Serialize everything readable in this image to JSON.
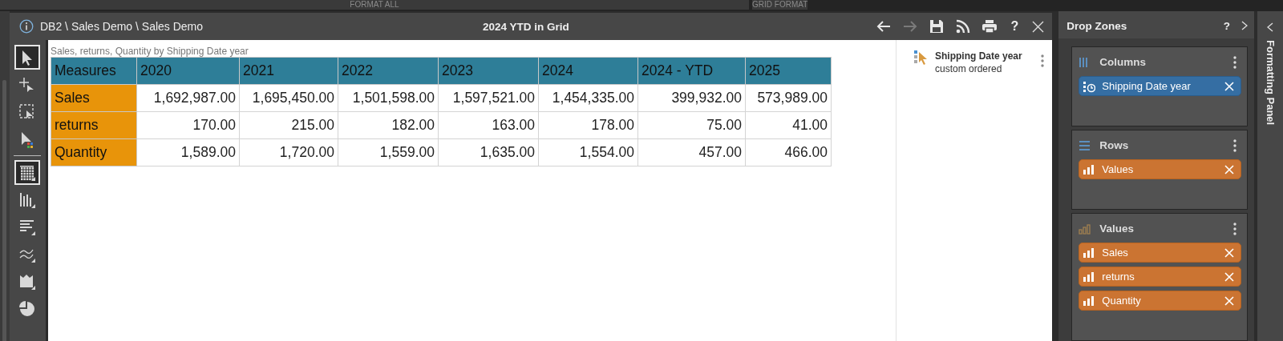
{
  "top_tabs": [
    {
      "label": "FORMAT ALL"
    },
    {
      "label": "GRID FORMAT"
    }
  ],
  "title_bar": {
    "path": "DB2 \\ Sales Demo \\ Sales Demo",
    "title": "2024 YTD in Grid",
    "help": "?",
    "actions": [
      {
        "kind": "back",
        "disabled": false
      },
      {
        "kind": "forward",
        "disabled": true
      },
      {
        "kind": "save",
        "disabled": false
      },
      {
        "kind": "feed",
        "disabled": false
      },
      {
        "kind": "print",
        "disabled": false
      }
    ]
  },
  "toolbar": [
    {
      "kind": "pointer",
      "selected": true
    },
    {
      "kind": "add",
      "selected": false
    },
    {
      "kind": "marquee",
      "selected": false
    },
    {
      "kind": "color-pointer",
      "selected": false
    },
    {
      "kind": "separator"
    },
    {
      "kind": "grid",
      "selected": true
    },
    {
      "kind": "columns",
      "selected": false
    },
    {
      "kind": "bars",
      "selected": false
    },
    {
      "kind": "lines",
      "selected": false
    },
    {
      "kind": "area",
      "selected": false
    },
    {
      "kind": "pie",
      "selected": false
    }
  ],
  "grid": {
    "caption": "Sales, returns, Quantity by Shipping Date year",
    "corner": "Measures",
    "columns": [
      "2020",
      "2021",
      "2022",
      "2023",
      "2024",
      "2024 - YTD",
      "2025"
    ],
    "rows": [
      {
        "label": "Sales",
        "cells": [
          "1,692,987.00",
          "1,695,450.00",
          "1,501,598.00",
          "1,597,521.00",
          "1,454,335.00",
          "399,932.00",
          "573,989.00"
        ]
      },
      {
        "label": "returns",
        "cells": [
          "170.00",
          "215.00",
          "182.00",
          "163.00",
          "178.00",
          "75.00",
          "41.00"
        ]
      },
      {
        "label": "Quantity",
        "cells": [
          "1,589.00",
          "1,720.00",
          "1,559.00",
          "1,635.00",
          "1,554.00",
          "457.00",
          "466.00"
        ]
      }
    ]
  },
  "field_list": [
    {
      "name": "Shipping Date year",
      "note": "custom ordered"
    }
  ],
  "drop_zones": {
    "title": "Drop Zones",
    "help": "?",
    "zones": [
      {
        "kind": "columns",
        "label": "Columns",
        "chips": [
          {
            "kind": "date",
            "label": "Shipping Date year"
          }
        ]
      },
      {
        "kind": "rows",
        "label": "Rows",
        "chips": [
          {
            "kind": "measure",
            "label": "Values"
          }
        ]
      },
      {
        "kind": "values",
        "label": "Values",
        "chips": [
          {
            "kind": "measure",
            "label": "Sales"
          },
          {
            "kind": "measure",
            "label": "returns"
          },
          {
            "kind": "measure",
            "label": "Quantity"
          }
        ]
      }
    ]
  },
  "formatting_panel": {
    "title": "Formatting Panel"
  }
}
